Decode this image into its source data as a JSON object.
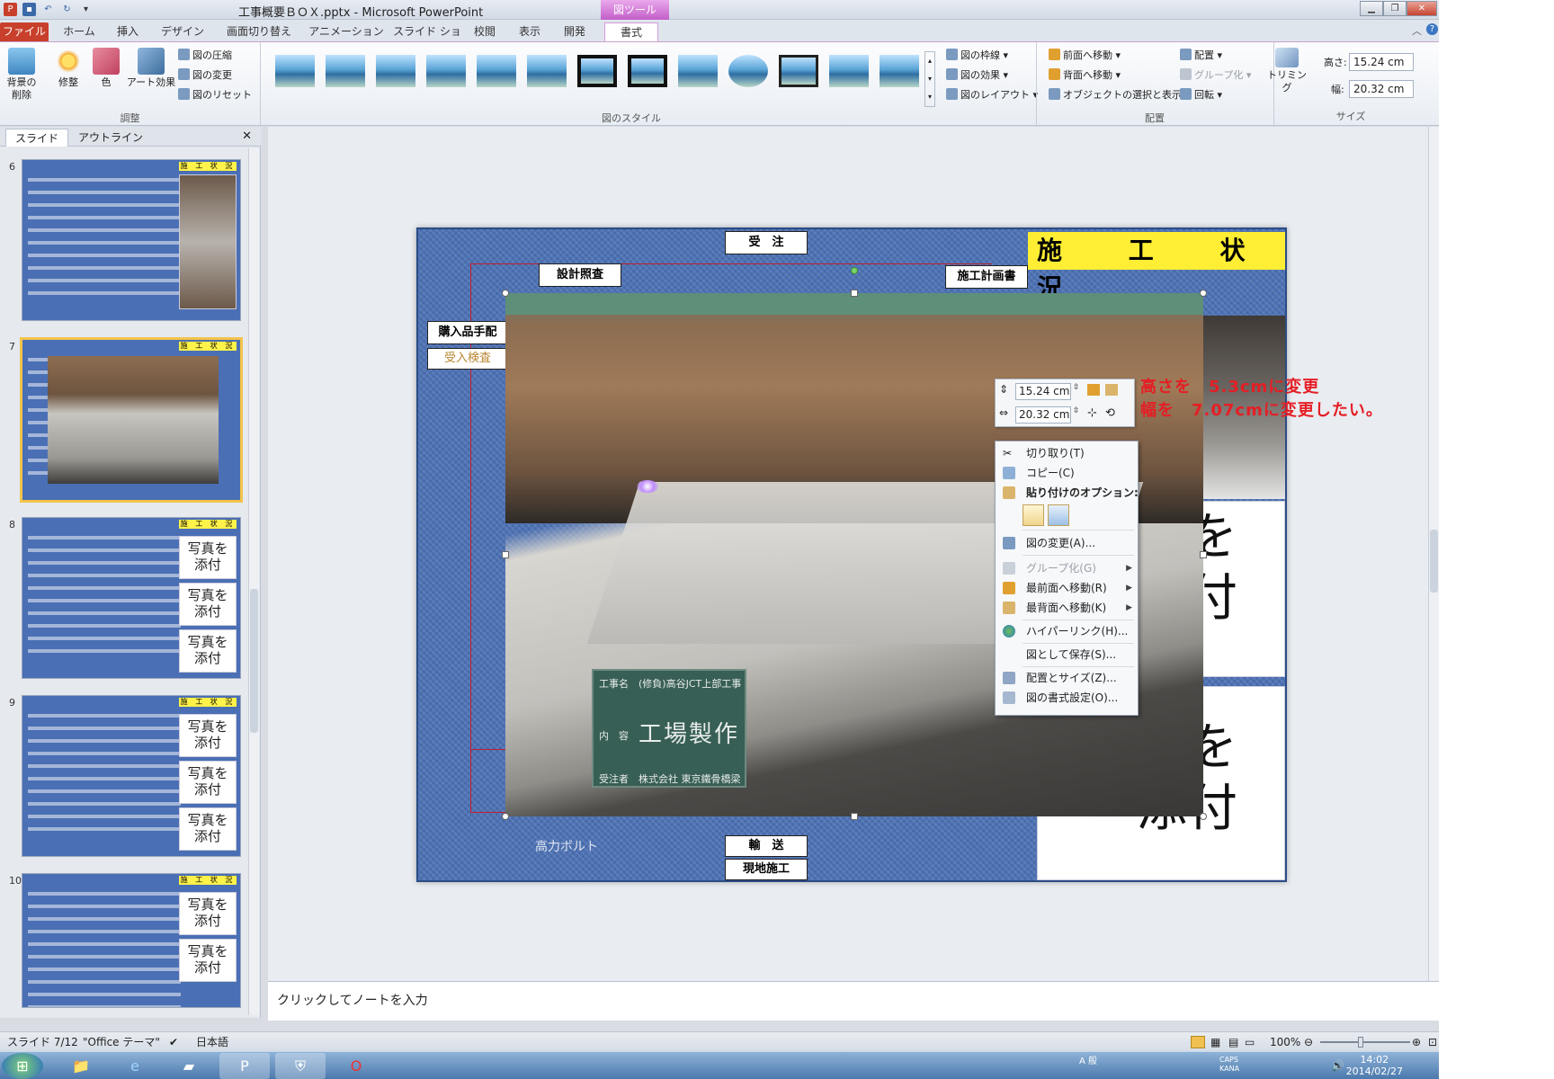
{
  "window": {
    "title": "工事概要ＢＯＸ.pptx - Microsoft PowerPoint",
    "context_tab_group": "図ツール"
  },
  "ribbon": {
    "tabs": [
      "ファイル",
      "ホーム",
      "挿入",
      "デザイン",
      "画面切り替え",
      "アニメーション",
      "スライド ショー",
      "校閲",
      "表示",
      "開発",
      "書式"
    ],
    "active_tab": "書式",
    "adjust": {
      "remove_bg": "背景の\n削除",
      "corrections": "修整",
      "color": "色",
      "art_effects": "アート効果",
      "compress": "図の圧縮",
      "change": "図の変更",
      "reset": "図のリセット",
      "label": "調整"
    },
    "styles": {
      "label": "図のスタイル",
      "border": "図の枠線",
      "effects": "図の効果",
      "layout": "図のレイアウト"
    },
    "arrange": {
      "bring_forward": "前面へ移動",
      "send_backward": "背面へ移動",
      "selection_pane": "オブジェクトの選択と表示",
      "align": "配置",
      "group": "グループ化",
      "rotate": "回転",
      "label": "配置"
    },
    "size": {
      "crop": "トリミング",
      "height_label": "高さ:",
      "height_value": "15.24 cm",
      "width_label": "幅:",
      "width_value": "20.32 cm",
      "label": "サイズ"
    }
  },
  "left_pane": {
    "tab_slides": "スライド",
    "tab_outline": "アウトライン",
    "thumb_header": "施 工 状 況",
    "thumb_cell_text": "写真を\n添付",
    "slides": [
      {
        "num": "6"
      },
      {
        "num": "7",
        "selected": true
      },
      {
        "num": "8"
      },
      {
        "num": "9"
      },
      {
        "num": "10"
      }
    ]
  },
  "slide": {
    "title": "施 工 状 況",
    "boxes": {
      "order": "受　注",
      "design_check": "設計照査",
      "construction_plan": "施工計画書",
      "purchase": "購入品手配",
      "inspection": "受入検査",
      "transport": "輸　送",
      "site_work": "現地施工",
      "bolt_label": "高力ボルト"
    },
    "right_text_1": "を\n付",
    "right_text_2": "を\n添付",
    "board": {
      "row1_label": "工事名",
      "row1_value": "(修負)高谷JCT上部工事",
      "row2_label": "内　容",
      "row2_value": "工場製作",
      "row3_label": "受注者",
      "row3_value": "株式会社 東京鐵骨橋梁"
    },
    "annotation": [
      "高さを　5.3cmに変更",
      "幅を　7.07cmに変更したい。"
    ]
  },
  "mini_toolbar": {
    "height": "15.24 cm",
    "width": "20.32 cm"
  },
  "context_menu": {
    "items": [
      {
        "label": "切り取り(T)",
        "disabled": false
      },
      {
        "label": "コピー(C)",
        "disabled": false
      },
      {
        "label": "貼り付けのオプション:",
        "disabled": false,
        "bold": true
      },
      {
        "label": "図の変更(A)...",
        "disabled": false
      },
      {
        "label": "グループ化(G)",
        "disabled": true,
        "submenu": true
      },
      {
        "label": "最前面へ移動(R)",
        "disabled": false,
        "submenu": true
      },
      {
        "label": "最背面へ移動(K)",
        "disabled": false,
        "submenu": true
      },
      {
        "label": "ハイパーリンク(H)...",
        "disabled": false
      },
      {
        "label": "図として保存(S)...",
        "disabled": false
      },
      {
        "label": "配置とサイズ(Z)...",
        "disabled": false
      },
      {
        "label": "図の書式設定(O)...",
        "disabled": false
      }
    ]
  },
  "notes": {
    "placeholder": "クリックしてノートを入力"
  },
  "status": {
    "slide": "スライド 7/12",
    "theme": "\"Office テーマ\"",
    "language": "日本語",
    "zoom": "100%"
  },
  "taskbar": {
    "time": "14:02",
    "date": "2014/02/27",
    "caps": "CAPS",
    "kana": "KANA"
  },
  "colors": {
    "file_tab": "#c8402b",
    "slide_bg": "#4d72b5",
    "title_yellow": "#ffee33",
    "annotation_red": "#e51e25"
  }
}
